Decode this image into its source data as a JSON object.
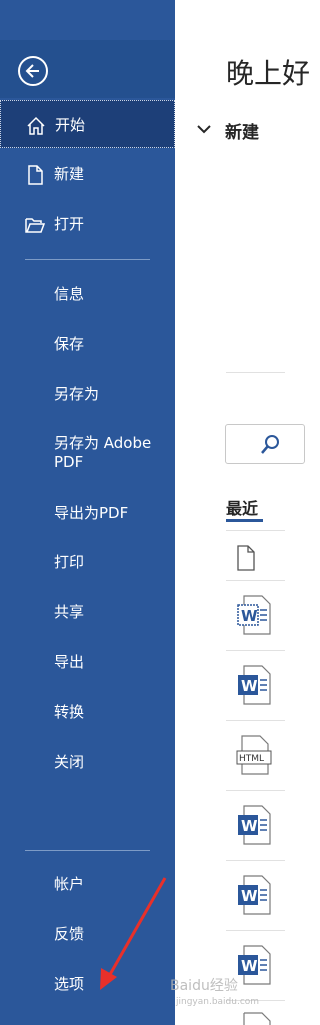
{
  "sidebar": {
    "items": [
      {
        "label": "开始",
        "icon": "home-icon"
      },
      {
        "label": "新建",
        "icon": "new-document-icon"
      },
      {
        "label": "打开",
        "icon": "folder-open-icon"
      },
      {
        "label": "信息"
      },
      {
        "label": "保存"
      },
      {
        "label": "另存为"
      },
      {
        "label": "另存为 Adobe PDF"
      },
      {
        "label": "导出为PDF"
      },
      {
        "label": "打印"
      },
      {
        "label": "共享"
      },
      {
        "label": "导出"
      },
      {
        "label": "转换"
      },
      {
        "label": "关闭"
      },
      {
        "label": "帐户"
      },
      {
        "label": "反馈"
      },
      {
        "label": "选项"
      }
    ]
  },
  "main": {
    "greeting": "晚上好",
    "new_section": "新建",
    "recent_tab": "最近"
  },
  "watermark": {
    "brand": "Baidu经验",
    "url": "jingyan.baidu.com"
  },
  "colors": {
    "sidebar_bg": "#2b579a",
    "active_bg": "#1d3f78",
    "annotation_arrow": "#e8302a"
  }
}
